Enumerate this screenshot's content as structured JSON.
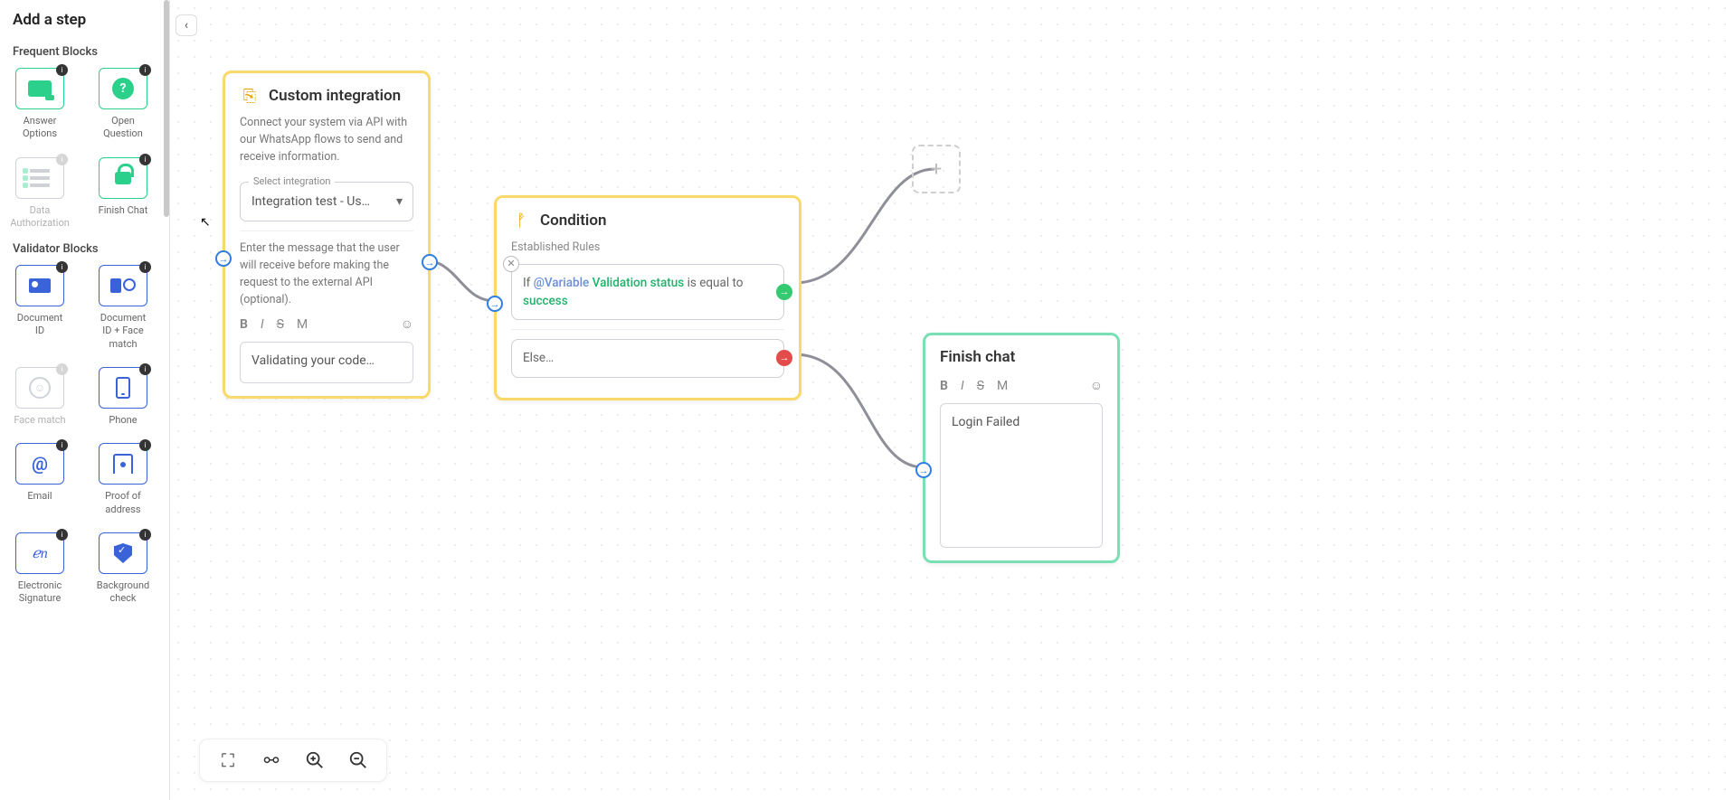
{
  "sidebar": {
    "title": "Add a step",
    "sections": {
      "frequent": {
        "title": "Frequent Blocks",
        "items": [
          {
            "label": "Answer Options"
          },
          {
            "label": "Open Question"
          },
          {
            "label": "Data Authorization"
          },
          {
            "label": "Finish Chat"
          }
        ]
      },
      "validators": {
        "title": "Validator Blocks",
        "items": [
          {
            "label": "Document ID"
          },
          {
            "label": "Document ID + Face match"
          },
          {
            "label": "Face match"
          },
          {
            "label": "Phone"
          },
          {
            "label": "Email"
          },
          {
            "label": "Proof of address"
          },
          {
            "label": "Electronic Signature"
          },
          {
            "label": "Background check"
          }
        ]
      }
    }
  },
  "nodes": {
    "integration": {
      "title": "Custom integration",
      "desc": "Connect your system via API with our WhatsApp flows to send and receive information.",
      "select_label": "Select integration",
      "select_value": "Integration test - Us…",
      "help_text": "Enter the message that the user will receive before making the request to the external API (optional).",
      "message": "Validating your code…"
    },
    "condition": {
      "title": "Condition",
      "subtitle": "Established Rules",
      "rule_if": "If",
      "rule_var": "@Variable",
      "rule_name": "Validation status",
      "rule_op": "is equal to",
      "rule_val": "success",
      "else_label": "Else…"
    },
    "finish": {
      "title": "Finish chat",
      "message": "Login Failed"
    }
  },
  "fmt": {
    "b": "B",
    "i": "I",
    "s": "S",
    "m": "M",
    "emoji": "☺"
  },
  "toolbar": {
    "fit": "⛶",
    "graph": "⚯",
    "zin": "⊕",
    "zout": "⊖"
  },
  "icons": {
    "collapse": "‹",
    "plus": "+",
    "arrow": "→",
    "close": "✕",
    "chev": "▾",
    "q": "?",
    "at": "@",
    "sig": "ℯn"
  }
}
